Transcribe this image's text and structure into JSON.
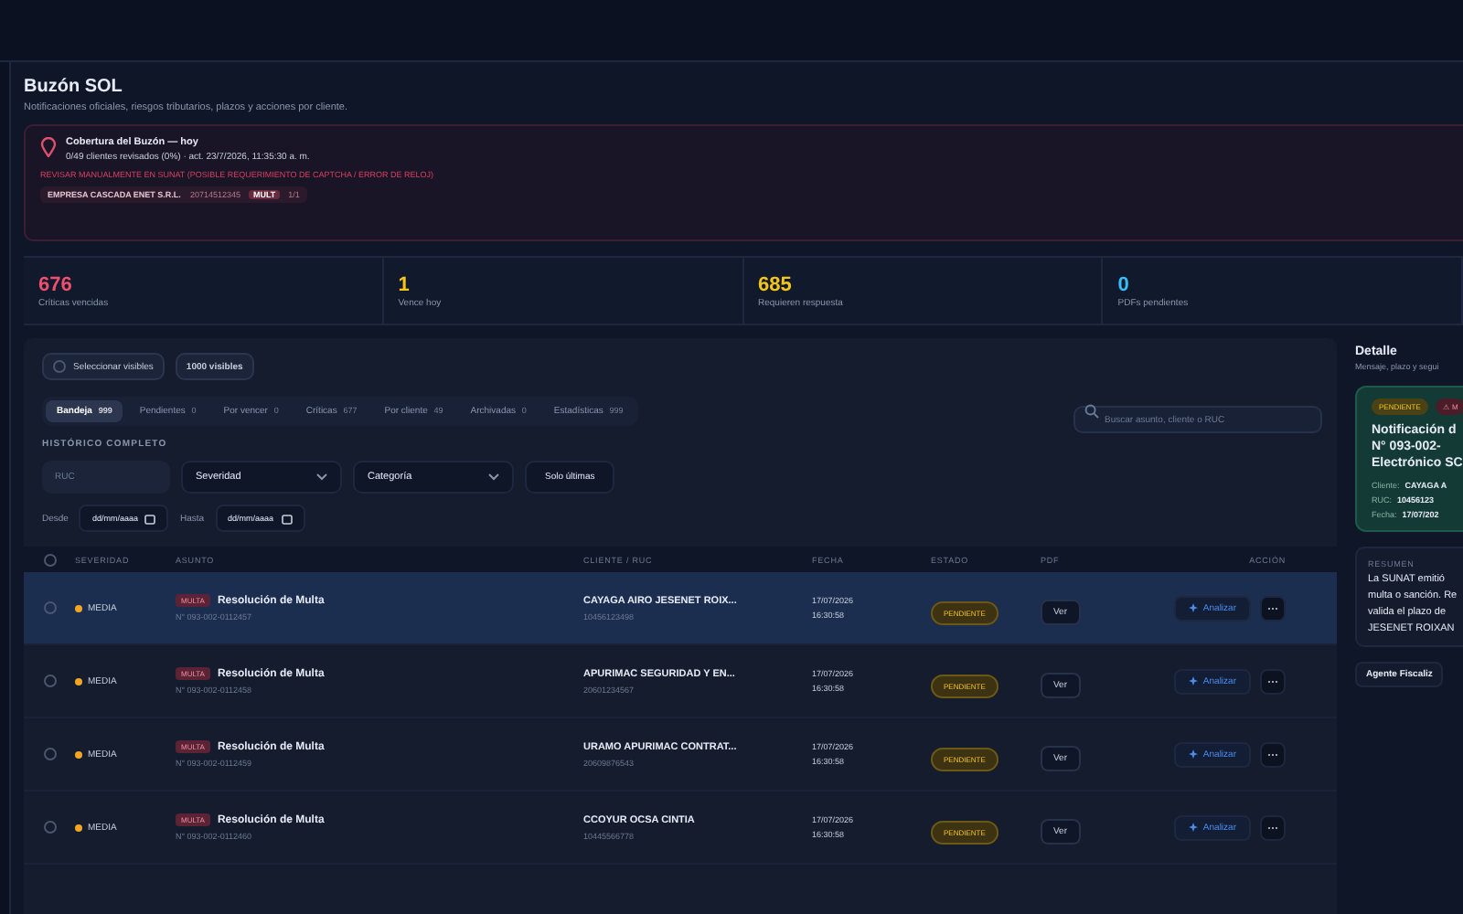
{
  "page": {
    "title": "Buzón SOL",
    "subtitle": "Notificaciones oficiales, riesgos tributarios, plazos y acciones por cliente."
  },
  "alert": {
    "title": "Cobertura del Buzón — hoy",
    "detail": "0/49 clientes revisados (0%) · act. 23/7/2026, 11:35:30 a. m.",
    "warning": "REVISAR MANUALMENTE EN SUNAT (POSIBLE REQUERIMIENTO DE CAPTCHA / ERROR DE RELOJ)",
    "chip": {
      "client": "EMPRESA CASCADA ENET S.R.L.",
      "ruc": "20714512345",
      "tag": "MULT",
      "count": "1/1"
    }
  },
  "stats": [
    {
      "value": "676",
      "label": "Críticas vencidas",
      "color": "#f0506e"
    },
    {
      "value": "1",
      "label": "Vence hoy",
      "color": "#f5c518"
    },
    {
      "value": "685",
      "label": "Requieren respuesta",
      "color": "#f5c518"
    },
    {
      "value": "0",
      "label": "PDFs pendientes",
      "color": "#38bdf8"
    }
  ],
  "toolbar": {
    "select_visible": "Seleccionar visibles",
    "visible_count": "1000 visibles"
  },
  "tabs": [
    {
      "label": "Bandeja",
      "count": "999",
      "selected": true
    },
    {
      "label": "Pendientes",
      "count": "0",
      "selected": false
    },
    {
      "label": "Por vencer",
      "count": "0",
      "selected": false
    },
    {
      "label": "Críticas",
      "count": "677",
      "selected": false
    },
    {
      "label": "Por cliente",
      "count": "49",
      "selected": false
    },
    {
      "label": "Archivadas",
      "count": "0",
      "selected": false
    },
    {
      "label": "Estadísticas",
      "count": "999",
      "selected": false
    }
  ],
  "search": {
    "placeholder": "Buscar asunto, cliente o RUC"
  },
  "history_label": "HISTÓRICO COMPLETO",
  "filters": {
    "ruc_placeholder": "RUC",
    "severity": "Severidad",
    "category": "Categoría",
    "latest_button": "Solo últimas",
    "from_label": "Desde",
    "from_value": "dd/mm/aaaa",
    "to_label": "Hasta",
    "to_value": "dd/mm/aaaa"
  },
  "table": {
    "select_all_checked": false,
    "columns": [
      "SEVERIDAD",
      "ASUNTO",
      "CLIENTE / RUC",
      "FECHA",
      "ESTADO",
      "PDF",
      "ACCIÓN"
    ],
    "rows": [
      {
        "selected": true,
        "checked": false,
        "severity": "MEDIA",
        "color": "#f5a524",
        "tag": "MULTA",
        "subject": "Resolución de Multa",
        "number": "N° 093-002-0112457",
        "client": "CAYAGA AIRO JESENET ROIX...",
        "ruc": "10456123498",
        "date": "17/07/2026",
        "time": "16:30:58",
        "status": "PENDIENTE",
        "pdf": "Ver",
        "action": "Analizar",
        "more": "⋯"
      },
      {
        "selected": false,
        "checked": false,
        "severity": "MEDIA",
        "color": "#f5a524",
        "tag": "MULTA",
        "subject": "Resolución de Multa",
        "number": "N° 093-002-0112458",
        "client": "APURIMAC SEGURIDAD Y EN...",
        "ruc": "20601234567",
        "date": "17/07/2026",
        "time": "16:30:58",
        "status": "PENDIENTE",
        "pdf": "Ver",
        "action": "Analizar",
        "more": "⋯"
      },
      {
        "selected": false,
        "checked": false,
        "severity": "MEDIA",
        "color": "#f5a524",
        "tag": "MULTA",
        "subject": "Resolución de Multa",
        "number": "N° 093-002-0112459",
        "client": "URAMO APURIMAC CONTRAT...",
        "ruc": "20609876543",
        "date": "17/07/2026",
        "time": "16:30:58",
        "status": "PENDIENTE",
        "pdf": "Ver",
        "action": "Analizar",
        "more": "⋯"
      },
      {
        "selected": false,
        "checked": false,
        "severity": "MEDIA",
        "color": "#f5a524",
        "tag": "MULTA",
        "subject": "Resolución de Multa",
        "number": "N° 093-002-0112460",
        "client": "CCOYUR OCSA CINTIA",
        "ruc": "10445566778",
        "date": "17/07/2026",
        "time": "16:30:58",
        "status": "PENDIENTE",
        "pdf": "Ver",
        "action": "Analizar",
        "more": "⋯"
      }
    ]
  },
  "detail": {
    "title": "Detalle",
    "subtitle": "Mensaje, plazo y segui",
    "badges": [
      "PENDIENTE",
      "⚠ M"
    ],
    "heading": [
      "Notificación d",
      "N° 093-002-",
      "Electrónico SC"
    ],
    "fields": [
      {
        "label": "Cliente:",
        "value": "CAYAGA A"
      },
      {
        "label": "RUC:",
        "value": "10456123"
      },
      {
        "label": "Fecha:",
        "value": "17/07/202"
      }
    ],
    "summary_label": "RESUMEN",
    "summary": [
      "La SUNAT emitió",
      "multa o sanción. Re",
      "valida el plazo de",
      "JESENET ROIXAN"
    ],
    "agent_button": "Agente Fiscaliz"
  }
}
